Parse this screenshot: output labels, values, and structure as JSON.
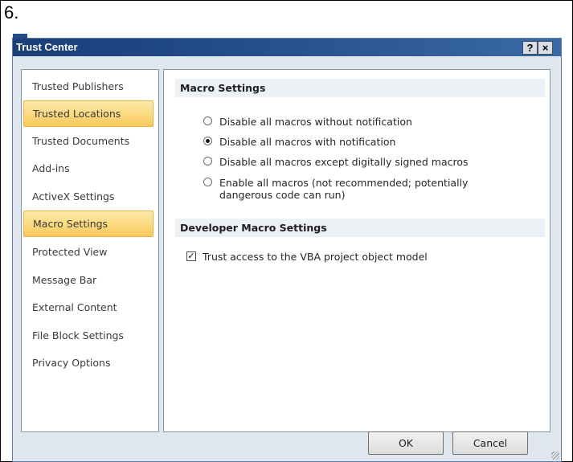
{
  "step_number": "6.",
  "window": {
    "title": "Trust Center",
    "help_label": "?",
    "close_label": "×"
  },
  "sidebar": {
    "items": [
      {
        "label": "Trusted Publishers"
      },
      {
        "label": "Trusted Locations"
      },
      {
        "label": "Trusted Documents"
      },
      {
        "label": "Add-ins"
      },
      {
        "label": "ActiveX Settings"
      },
      {
        "label": "Macro Settings"
      },
      {
        "label": "Protected View"
      },
      {
        "label": "Message Bar"
      },
      {
        "label": "External Content"
      },
      {
        "label": "File Block Settings"
      },
      {
        "label": "Privacy Options"
      }
    ],
    "selected": "Macro Settings",
    "hovered": "Trusted Locations"
  },
  "macro_settings": {
    "header": "Macro Settings",
    "options": [
      {
        "line1": "Disable all macros without notification",
        "line2": "",
        "checked": false
      },
      {
        "line1": "Disable all macros with notification",
        "line2": "",
        "checked": true
      },
      {
        "line1": "Disable all macros except digitally signed macros",
        "line2": "",
        "checked": false
      },
      {
        "line1": "Enable all macros (not recommended; potentially",
        "line2": "dangerous code can run)",
        "checked": false
      }
    ]
  },
  "developer_settings": {
    "header": "Developer Macro Settings",
    "trust_vba_label": "Trust access to the VBA project object model",
    "trust_vba_checked": true,
    "check_mark": "✓"
  },
  "buttons": {
    "ok": "OK",
    "cancel": "Cancel"
  },
  "colors": {
    "titlebar": "#234c8a",
    "highlight": "#fbd77a",
    "dialog_bg": "#dfe6ee"
  }
}
